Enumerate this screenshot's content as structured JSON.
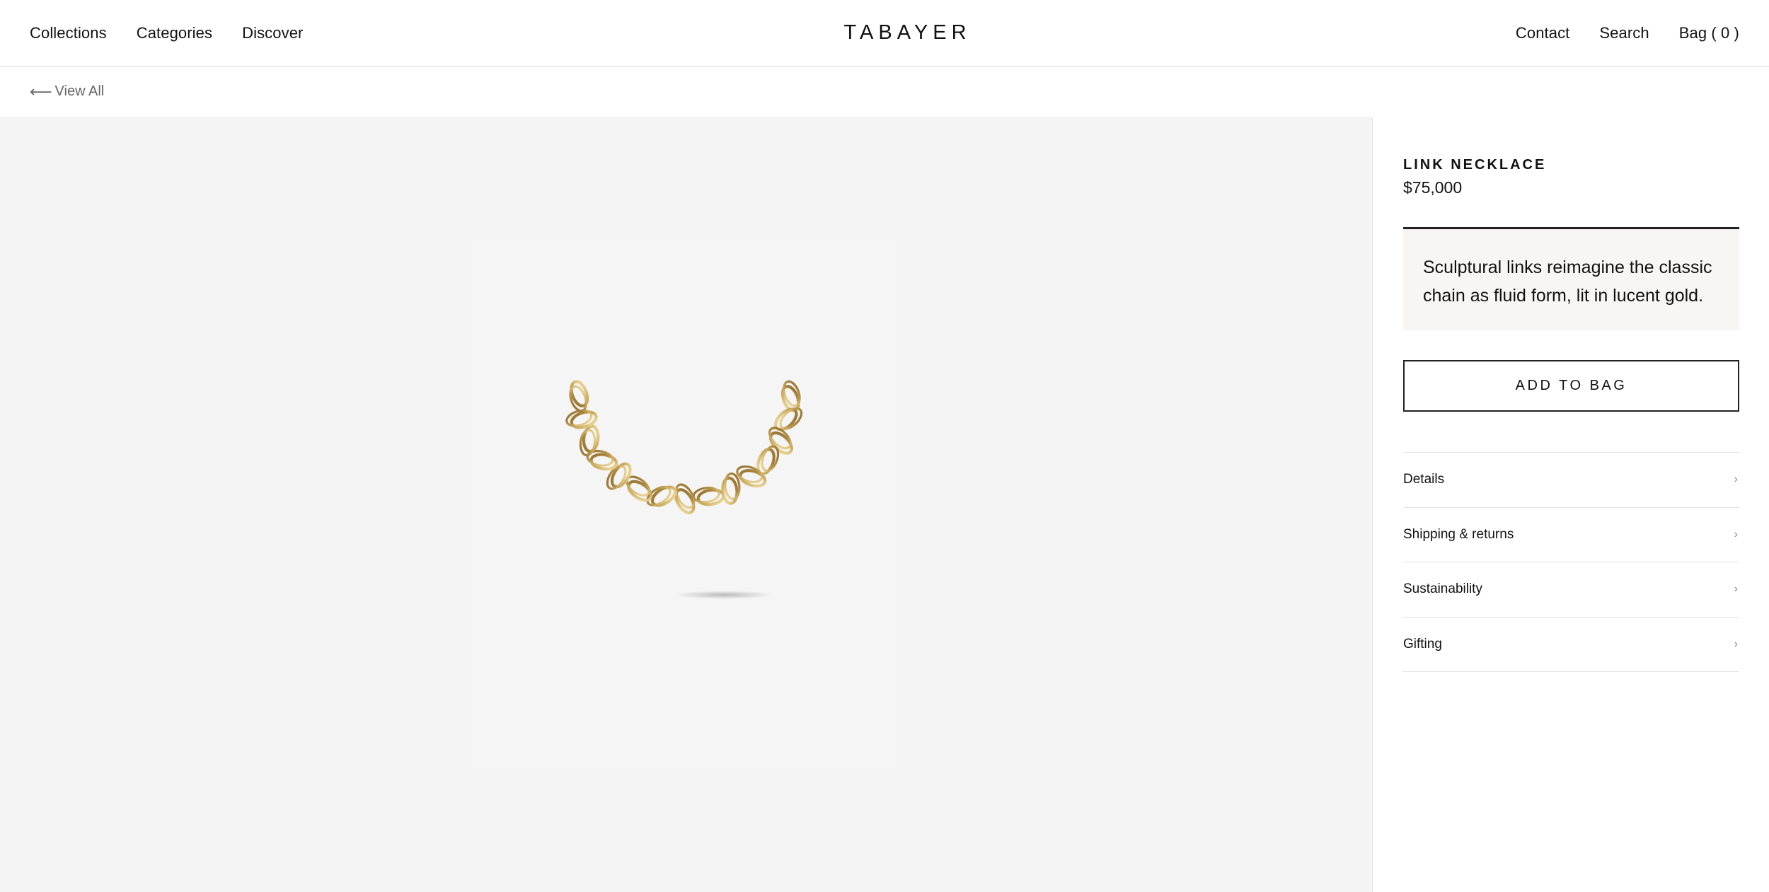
{
  "header": {
    "logo": "TABAYER",
    "nav_left": [
      "Collections",
      "Categories",
      "Discover"
    ],
    "nav_right": [
      "Contact",
      "Search",
      "Bag ( 0 )"
    ]
  },
  "subbar": {
    "back_arrow_icon": "arrow-left-icon",
    "back_label": "View All"
  },
  "product": {
    "name": "LINK NECKLACE",
    "price": "$75,000",
    "description": "Sculptural links reimagine the classic chain as fluid form, lit in lucent gold.",
    "add_to_bag": "ADD TO BAG",
    "accordion": [
      "Details",
      "Shipping & returns",
      "Sustainability",
      "Gifting"
    ],
    "chevron_icon": "chevron-right-icon"
  },
  "colors": {
    "gallery_bg": "#f4f4f4",
    "description_bg": "#f7f6f2",
    "gold": "#c9a75a"
  }
}
